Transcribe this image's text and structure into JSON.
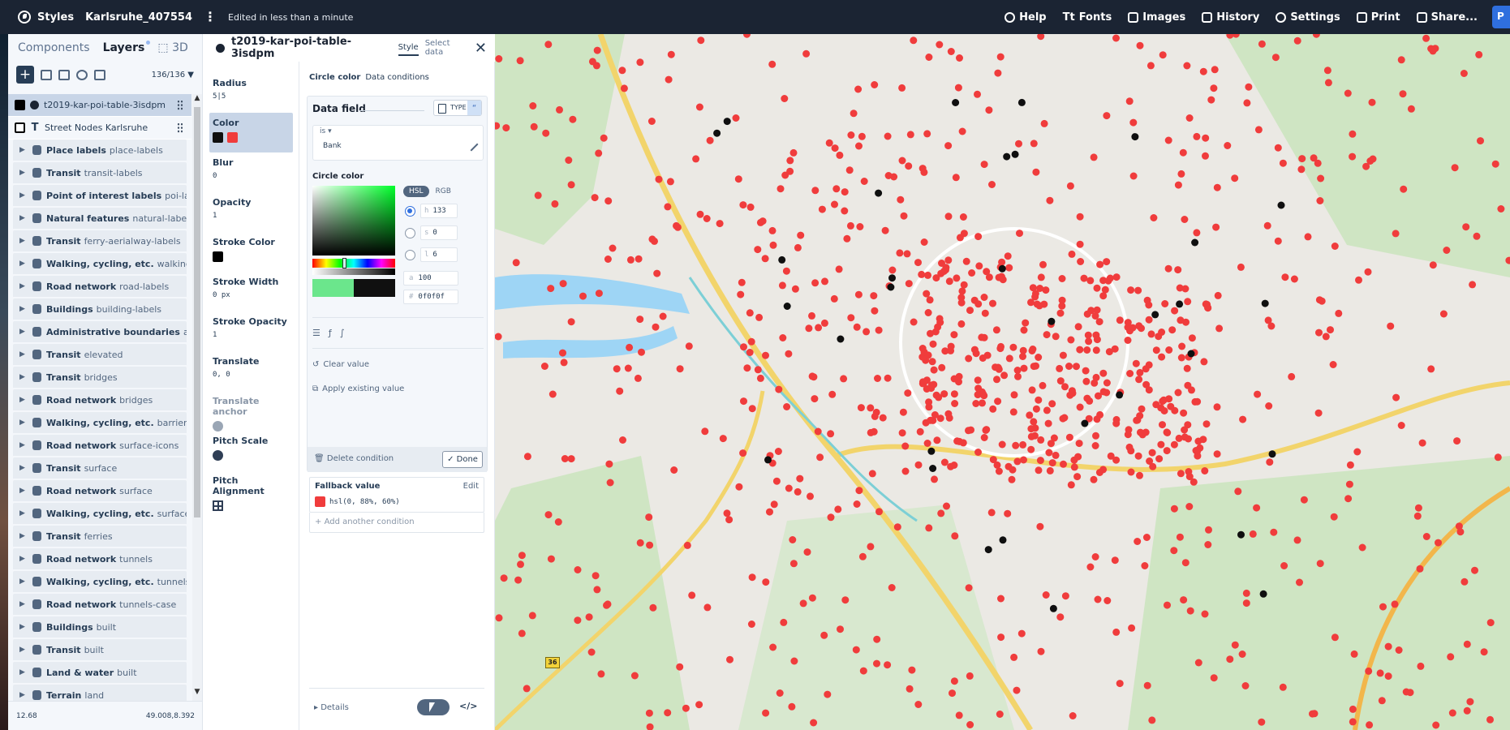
{
  "topbar": {
    "app_name": "Styles",
    "style_name": "Karlsruhe_407554",
    "status": "Edited in less than a minute",
    "items": {
      "help": "Help",
      "fonts": "Fonts",
      "images": "Images",
      "history": "History",
      "settings": "Settings",
      "print": "Print",
      "share": "Share...",
      "publish": "P"
    }
  },
  "layers_panel": {
    "tabs": {
      "components": "Components",
      "layers": "Layers",
      "threed": "3D"
    },
    "count": "136/136",
    "selected_layer": "t2019-kar-poi-table-3isdpm",
    "text_layer": "Street Nodes Karlsruhe",
    "groups": [
      {
        "name": "Place labels",
        "sub": "place-labels",
        "icon": "transit-icon"
      },
      {
        "name": "Transit",
        "sub": "transit-labels",
        "icon": "transit-icon"
      },
      {
        "name": "Point of interest labels",
        "sub": "poi-labels",
        "icon": "pin-icon"
      },
      {
        "name": "Natural features",
        "sub": "natural-labels",
        "icon": "mountain-icon"
      },
      {
        "name": "Transit",
        "sub": "ferry-aerialway-labels",
        "icon": "transit-icon"
      },
      {
        "name": "Walking, cycling, etc.",
        "sub": "walking-cycli",
        "icon": "walker-icon"
      },
      {
        "name": "Road network",
        "sub": "road-labels",
        "icon": "road-icon"
      },
      {
        "name": "Buildings",
        "sub": "building-labels",
        "icon": "building-icon"
      },
      {
        "name": "Administrative boundaries",
        "sub": "admir",
        "icon": "boundary-icon"
      },
      {
        "name": "Transit",
        "sub": "elevated",
        "icon": "transit-icon"
      },
      {
        "name": "Transit",
        "sub": "bridges",
        "icon": "transit-icon"
      },
      {
        "name": "Road network",
        "sub": "bridges",
        "icon": "road-icon"
      },
      {
        "name": "Walking, cycling, etc.",
        "sub": "barriers-bric",
        "icon": "walker-icon"
      },
      {
        "name": "Road network",
        "sub": "surface-icons",
        "icon": "road-icon"
      },
      {
        "name": "Transit",
        "sub": "surface",
        "icon": "transit-icon"
      },
      {
        "name": "Road network",
        "sub": "surface",
        "icon": "road-icon"
      },
      {
        "name": "Walking, cycling, etc.",
        "sub": "surface",
        "icon": "walker-icon"
      },
      {
        "name": "Transit",
        "sub": "ferries",
        "icon": "transit-icon"
      },
      {
        "name": "Road network",
        "sub": "tunnels",
        "icon": "road-icon"
      },
      {
        "name": "Walking, cycling, etc.",
        "sub": "tunnels",
        "icon": "walker-icon"
      },
      {
        "name": "Road network",
        "sub": "tunnels-case",
        "icon": "road-icon"
      },
      {
        "name": "Buildings",
        "sub": "built",
        "icon": "building-icon"
      },
      {
        "name": "Transit",
        "sub": "built",
        "icon": "transit-icon"
      },
      {
        "name": "Land & water",
        "sub": "built",
        "icon": "globe-icon"
      },
      {
        "name": "Terrain",
        "sub": "land",
        "icon": "terrain-icon"
      }
    ],
    "zoom": "12.68",
    "coords": "49.008,8.392"
  },
  "props": {
    "layer_title": "t2019-kar-poi-table-3isdpm",
    "tab_style": "Style",
    "tab_select": "Select data",
    "radius_label": "Radius",
    "radius_value": "5|5",
    "color_label": "Color",
    "blur_label": "Blur",
    "blur_value": "0",
    "opacity_label": "Opacity",
    "opacity_value": "1",
    "stroke_color_label": "Stroke Color",
    "stroke_width_label": "Stroke Width",
    "stroke_width_value": "0 px",
    "stroke_opacity_label": "Stroke Opacity",
    "stroke_opacity_value": "1",
    "translate_label": "Translate",
    "translate_value": "0, 0",
    "translate_anchor_label": "Translate anchor",
    "pitch_scale_label": "Pitch Scale",
    "pitch_alignment_label": "Pitch Alignment"
  },
  "editor": {
    "crumb_1": "Circle color",
    "crumb_2": "Data conditions",
    "data_field": "Data field",
    "type_label": "TYPE",
    "is_label": "is",
    "is_value": "Bank",
    "circle_color": "Circle color",
    "mode_hsl": "HSL",
    "mode_rgb": "RGB",
    "h_label": "h",
    "h_value": "133",
    "s_label": "s",
    "s_value": "0",
    "l_label": "l",
    "l_value": "6",
    "a_label": "a",
    "a_value": "100",
    "hex_label": "#",
    "hex_value": "0f0f0f",
    "clear_value": "Clear value",
    "apply_existing": "Apply existing value",
    "delete_condition": "Delete condition",
    "done": "Done",
    "fallback_label": "Fallback value",
    "fallback_edit": "Edit",
    "fallback_value": "hsl(0, 88%, 60%)",
    "add_condition": "Add another condition",
    "details": "Details",
    "code_icon": "</>"
  },
  "map": {
    "route_shield": "36"
  },
  "colors": {
    "topbar": "#1b2433",
    "accent": "#2f6fde",
    "poi_red": "#f03c3c",
    "bank_black": "#0f0f0f",
    "selected": "#c8d5e7"
  }
}
